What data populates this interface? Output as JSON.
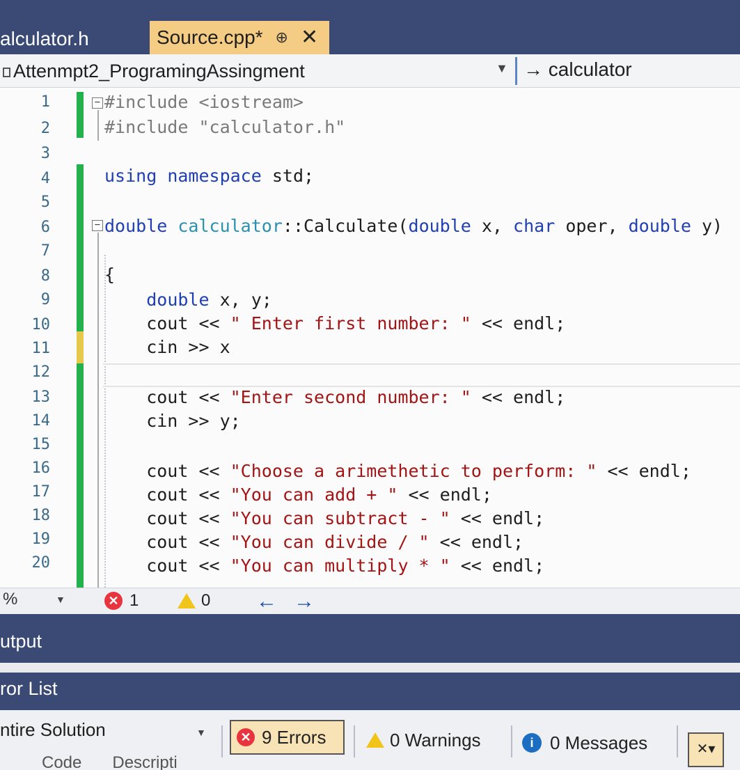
{
  "tabs": {
    "inactive_label": "alculator.h",
    "active_label": "Source.cpp*",
    "pin_icon": "pin-icon",
    "close_icon": "close-icon"
  },
  "navbar": {
    "project": "Attenmpt2_ProgramingAssingment",
    "member": "calculator",
    "member_arrow": "→"
  },
  "editor": {
    "line_numbers": [
      "1",
      "2",
      "3",
      "4",
      "5",
      "6",
      "7",
      "8",
      "9",
      "10",
      "11",
      "12",
      "13",
      "14",
      "15",
      "16",
      "17",
      "18",
      "19",
      "20"
    ],
    "lines": [
      "#include <iostream>",
      "#include \"calculator.h\"",
      "",
      "using namespace std;",
      "",
      "double calculator::Calculate(double x, char oper, double y)",
      "",
      "{",
      "    double x, y;",
      "    cout << \" Enter first number: \" << endl;",
      "    cin >> x",
      "",
      "    cout << \"Enter second number: \" << endl;",
      "    cin >> y;",
      "",
      "    cout << \"Choose a arimethetic to perform: \" << endl;",
      "    cout << \"You can add + \" << endl;",
      "    cout << \"You can subtract - \" << endl;",
      "    cout << \"You can divide / \" << endl;",
      "    cout << \"You can multiply * \" << endl;"
    ]
  },
  "status": {
    "zoom": "%",
    "error_count": "1",
    "warning_count": "0",
    "back_arrow": "←",
    "forward_arrow": "→"
  },
  "panels": {
    "output": "utput",
    "error_list": "ror List"
  },
  "error_list": {
    "scope": "ntire Solution",
    "errors_label": "9 Errors",
    "warnings_label": "0 Warnings",
    "messages_label": "0 Messages",
    "col_code": "Code",
    "col_desc": "Descripti"
  },
  "colors": {
    "tab_active": "#f5cc84",
    "chrome": "#3b4a75",
    "keyword": "#1f3fb3",
    "string": "#a31515",
    "change_saved": "#22b14c",
    "change_unsaved": "#e6c84a"
  }
}
